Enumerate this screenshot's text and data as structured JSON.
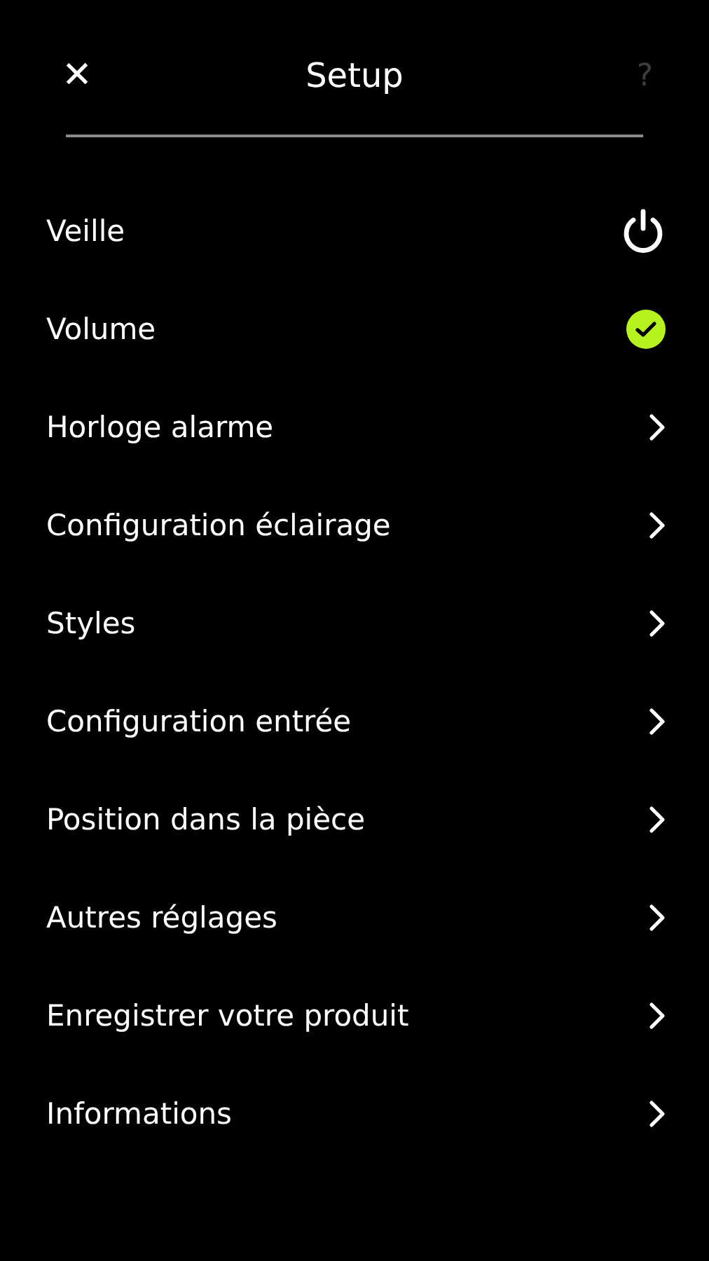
{
  "header": {
    "close": "✕",
    "title": "Setup",
    "help": {
      "label": "?",
      "disabled": true
    }
  },
  "items": [
    {
      "label": "Veille",
      "kind": "power"
    },
    {
      "label": "Volume",
      "kind": "check"
    },
    {
      "label": "Horloge alarme",
      "kind": "chevron"
    },
    {
      "label": "Configuration éclairage",
      "kind": "chevron"
    },
    {
      "label": "Styles",
      "kind": "chevron"
    },
    {
      "label": "Configuration entrée",
      "kind": "chevron"
    },
    {
      "label": "Position dans la pièce",
      "kind": "chevron"
    },
    {
      "label": "Autres réglages",
      "kind": "chevron"
    },
    {
      "label": "Enregistrer votre produit",
      "kind": "chevron"
    },
    {
      "label": "Informations",
      "kind": "chevron"
    }
  ]
}
